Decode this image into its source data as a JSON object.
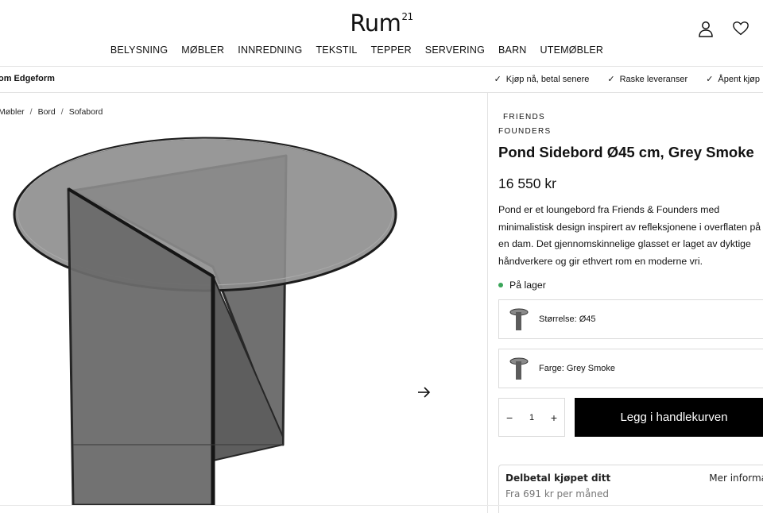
{
  "header": {
    "logo_text": "Rum",
    "logo_superscript": "21",
    "icons": [
      "user-icon",
      "heart-icon"
    ]
  },
  "nav": {
    "items": [
      "BELYSNING",
      "MØBLER",
      "INNREDNING",
      "TEKSTIL",
      "TEPPER",
      "SERVERING",
      "BARN",
      "UTEMØBLER"
    ]
  },
  "promo": {
    "brand_crumb": "om Edgeform",
    "usps": [
      "Kjøp nå, betal senere",
      "Raske leveranser",
      "Åpent kjøp"
    ]
  },
  "breadcrumb": [
    "Møbler",
    "Bord",
    "Sofabord"
  ],
  "product": {
    "brand_line1": "FRIENDS",
    "brand_line2": "FOUNDERS",
    "title": "Pond Sidebord Ø45 cm, Grey Smoke",
    "price": "16 550 kr",
    "description": "Pond er et loungebord fra Friends & Founders med minimalistisk design inspirert av refleksjonene i overflaten på en dam. Det gjennomskinnelige glasset er laget av dyktige håndverkere og gir ethvert rom en moderne vri.",
    "stock": "På lager",
    "options": [
      {
        "label": "Størrelse: Ø45"
      },
      {
        "label": "Farge: Grey Smoke"
      }
    ],
    "quantity": "1",
    "add_to_cart": "Legg i handlekurven"
  },
  "klarna": {
    "title": "Delbetal kjøpet ditt",
    "subtitle": "Fra 691 kr per måned",
    "more": "Mer informa"
  },
  "colors": {
    "accent": "#000000",
    "stock_green": "#3aa559",
    "border": "#dadada"
  }
}
